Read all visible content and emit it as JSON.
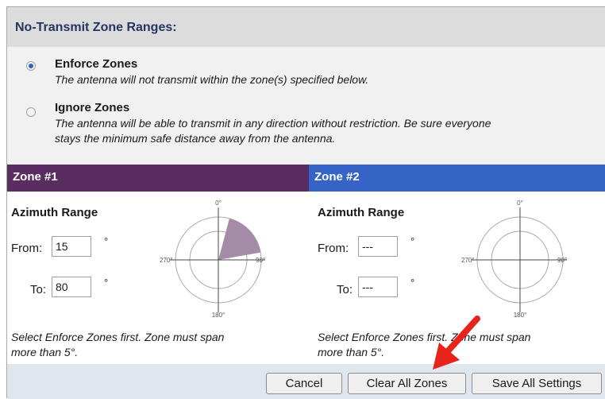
{
  "header": {
    "title": "No-Transmit Zone Ranges:"
  },
  "options": [
    {
      "label": "Enforce Zones",
      "desc": "The antenna will not transmit within the zone(s) specified below.",
      "selected": true
    },
    {
      "label": "Ignore Zones",
      "desc_line1": "The antenna will be able to transmit in any direction without restriction. Be sure everyone",
      "desc_line2": "stays the minimum safe distance away from the antenna.",
      "selected": false
    }
  ],
  "zones": [
    {
      "title": "Zone #1",
      "header_color": "#5a2d62",
      "azimuth_title": "Azimuth Range",
      "from_label": "From:",
      "from_value": "15",
      "to_label": "To:",
      "to_value": "80",
      "deg_symbol": "°",
      "note_line1": "Select Enforce Zones first. Zone must span",
      "note_line2": "more than 5°.",
      "sector_start_deg": 15,
      "sector_end_deg": 80
    },
    {
      "title": "Zone #2",
      "header_color": "#3564c6",
      "azimuth_title": "Azimuth Range",
      "from_label": "From:",
      "from_value": "---",
      "to_label": "To:",
      "to_value": "---",
      "deg_symbol": "°",
      "note_line1": "Select Enforce Zones first. Zone must span",
      "note_line2": "more than 5°."
    }
  ],
  "polar_labels": {
    "top": "0°",
    "right": "90°",
    "bottom": "180°",
    "left": "270°"
  },
  "buttons": {
    "cancel": "Cancel",
    "clear": "Clear All Zones",
    "save": "Save All Settings"
  },
  "colors": {
    "sector_fill": "#a48ca8",
    "arrow": "#e8231b"
  }
}
